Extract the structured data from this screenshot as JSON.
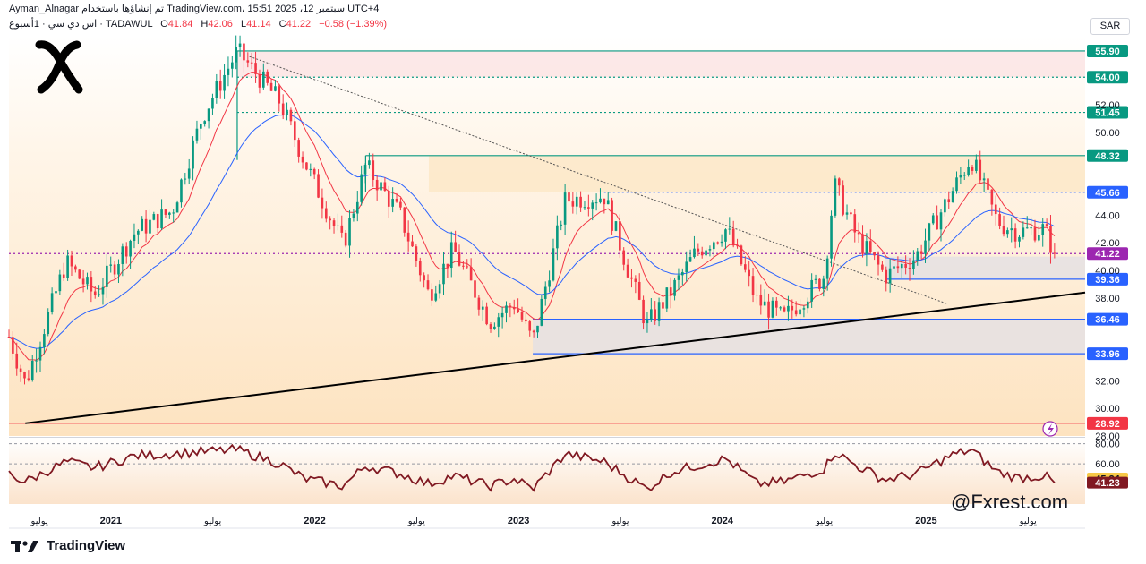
{
  "header": {
    "line1": "Ayman_Alnagar تم إنشاؤها باستخدام TradingView.com، سبتمبر 12، 2025 15:51 UTC+4",
    "line2_symbol": "اس دي سي · 1أسبوع · TADAWUL",
    "ohlc": {
      "O_label": "O",
      "O": "41.84",
      "H_label": "H",
      "H": "42.06",
      "L_label": "L",
      "L": "41.14",
      "C_label": "C",
      "C": "41.22",
      "change": "−0.58 (−1.39%)"
    }
  },
  "currency": "SAR",
  "watermark": "@Fxrest.com",
  "footer_brand": "TradingView",
  "colors": {
    "up": "#089981",
    "down": "#f23645",
    "ema_fast": "#f23645",
    "ema_slow": "#2962ff",
    "rsi": "#801922",
    "green_level": "#089981",
    "blue_level": "#2962ff",
    "red_level": "#f23645"
  },
  "chart_data": {
    "type": "candlestick",
    "y_range": [
      28,
      57
    ],
    "y_ticks": [
      {
        "value": 52,
        "label": "52.00"
      },
      {
        "value": 50,
        "label": "50.00"
      },
      {
        "value": 44,
        "label": "44.00"
      },
      {
        "value": 42,
        "label": "42.00"
      },
      {
        "value": 40,
        "label": "40.00"
      },
      {
        "value": 38,
        "label": "38.00"
      },
      {
        "value": 32,
        "label": "32.00"
      },
      {
        "value": 30,
        "label": "30.00"
      },
      {
        "value": 28,
        "label": "28.00"
      }
    ],
    "x_ticks": [
      {
        "t": 0.15,
        "label": "يوليو"
      },
      {
        "t": 0.5,
        "label": "2021"
      },
      {
        "t": 1.0,
        "label": "يوليو"
      },
      {
        "t": 1.5,
        "label": "2022"
      },
      {
        "t": 2.0,
        "label": "يوليو"
      },
      {
        "t": 2.5,
        "label": "2023"
      },
      {
        "t": 3.0,
        "label": "يوليو"
      },
      {
        "t": 3.5,
        "label": "2024"
      },
      {
        "t": 4.0,
        "label": "يوليو"
      },
      {
        "t": 4.5,
        "label": "2025"
      },
      {
        "t": 5.0,
        "label": "يوليو"
      }
    ],
    "levels": [
      {
        "value": 55.9,
        "label": "55.90",
        "color": "#089981",
        "style": "solid"
      },
      {
        "value": 54.0,
        "label": "54.00",
        "color": "#089981",
        "style": "dotted"
      },
      {
        "value": 51.45,
        "label": "51.45",
        "color": "#089981",
        "style": "dotted"
      },
      {
        "value": 48.32,
        "label": "48.32",
        "color": "#089981",
        "style": "solid"
      },
      {
        "value": 45.66,
        "label": "45.66",
        "color": "#2962ff",
        "style": "dotted"
      },
      {
        "value": 41.22,
        "label": "41.22",
        "color": "#9c27b0",
        "style": "dotted"
      },
      {
        "value": 39.36,
        "label": "39.36",
        "color": "#2962ff",
        "style": "solid"
      },
      {
        "value": 36.46,
        "label": "36.46",
        "color": "#2962ff",
        "style": "solid"
      },
      {
        "value": 33.96,
        "label": "33.96",
        "color": "#2962ff",
        "style": "solid"
      },
      {
        "value": 28.92,
        "label": "28.92",
        "color": "#f23645",
        "style": "solid"
      }
    ],
    "zones": [
      {
        "from": 54.0,
        "to": 55.9,
        "color": "#fce4e4"
      },
      {
        "from": 45.66,
        "to": 48.32,
        "color": "#fde7c8"
      },
      {
        "from": 39.36,
        "to": 41.0,
        "color": "#e5e1e3"
      },
      {
        "from": 33.96,
        "to": 36.46,
        "color": "#e5e1e3"
      }
    ],
    "anchors": [
      [
        0,
        35.2
      ],
      [
        0.08,
        31.8
      ],
      [
        0.28,
        40.6
      ],
      [
        0.42,
        38.2
      ],
      [
        0.62,
        42.8
      ],
      [
        0.8,
        44.3
      ],
      [
        0.95,
        51.2
      ],
      [
        1.12,
        55.9
      ],
      [
        1.33,
        52.2
      ],
      [
        1.45,
        47.9
      ],
      [
        1.64,
        41.8
      ],
      [
        1.75,
        47.6
      ],
      [
        1.92,
        44.0
      ],
      [
        2.06,
        38.2
      ],
      [
        2.18,
        41.5
      ],
      [
        2.36,
        36.3
      ],
      [
        2.48,
        37.6
      ],
      [
        2.57,
        34.8
      ],
      [
        2.73,
        45.1
      ],
      [
        2.92,
        45.4
      ],
      [
        3.05,
        39.5
      ],
      [
        3.13,
        36.0
      ],
      [
        3.25,
        38.5
      ],
      [
        3.37,
        41.3
      ],
      [
        3.52,
        43.0
      ],
      [
        3.67,
        37.8
      ],
      [
        3.8,
        36.5
      ],
      [
        4.0,
        39.6
      ],
      [
        4.05,
        46.2
      ],
      [
        4.16,
        42.4
      ],
      [
        4.3,
        39.6
      ],
      [
        4.45,
        41.0
      ],
      [
        4.62,
        45.5
      ],
      [
        4.72,
        48.2
      ],
      [
        4.85,
        43.5
      ],
      [
        4.95,
        42.8
      ],
      [
        5.08,
        43.0
      ],
      [
        5.13,
        41.22
      ]
    ],
    "rsi": {
      "y_range": [
        20,
        85
      ],
      "ticks": [
        {
          "value": 80,
          "label": "80.00"
        },
        {
          "value": 60,
          "label": "60.00"
        }
      ],
      "current": [
        {
          "value": 45.34,
          "label": "45.34",
          "color": "#f7c948"
        },
        {
          "value": 41.23,
          "label": "41.23",
          "color": "#801922"
        }
      ],
      "anchors": [
        [
          0,
          50
        ],
        [
          0.08,
          42
        ],
        [
          0.28,
          62
        ],
        [
          0.42,
          56
        ],
        [
          0.62,
          68
        ],
        [
          0.8,
          70
        ],
        [
          0.95,
          72
        ],
        [
          1.12,
          74
        ],
        [
          1.33,
          60
        ],
        [
          1.45,
          45
        ],
        [
          1.64,
          38
        ],
        [
          1.75,
          58
        ],
        [
          1.92,
          50
        ],
        [
          2.06,
          40
        ],
        [
          2.18,
          48
        ],
        [
          2.36,
          38
        ],
        [
          2.48,
          45
        ],
        [
          2.57,
          35
        ],
        [
          2.73,
          70
        ],
        [
          2.92,
          62
        ],
        [
          3.05,
          45
        ],
        [
          3.13,
          35
        ],
        [
          3.25,
          52
        ],
        [
          3.37,
          58
        ],
        [
          3.52,
          65
        ],
        [
          3.67,
          40
        ],
        [
          3.8,
          42
        ],
        [
          4.0,
          55
        ],
        [
          4.05,
          72
        ],
        [
          4.16,
          58
        ],
        [
          4.3,
          44
        ],
        [
          4.45,
          50
        ],
        [
          4.62,
          68
        ],
        [
          4.72,
          74
        ],
        [
          4.85,
          52
        ],
        [
          4.95,
          46
        ],
        [
          5.08,
          48
        ],
        [
          5.13,
          41.23
        ]
      ]
    }
  }
}
